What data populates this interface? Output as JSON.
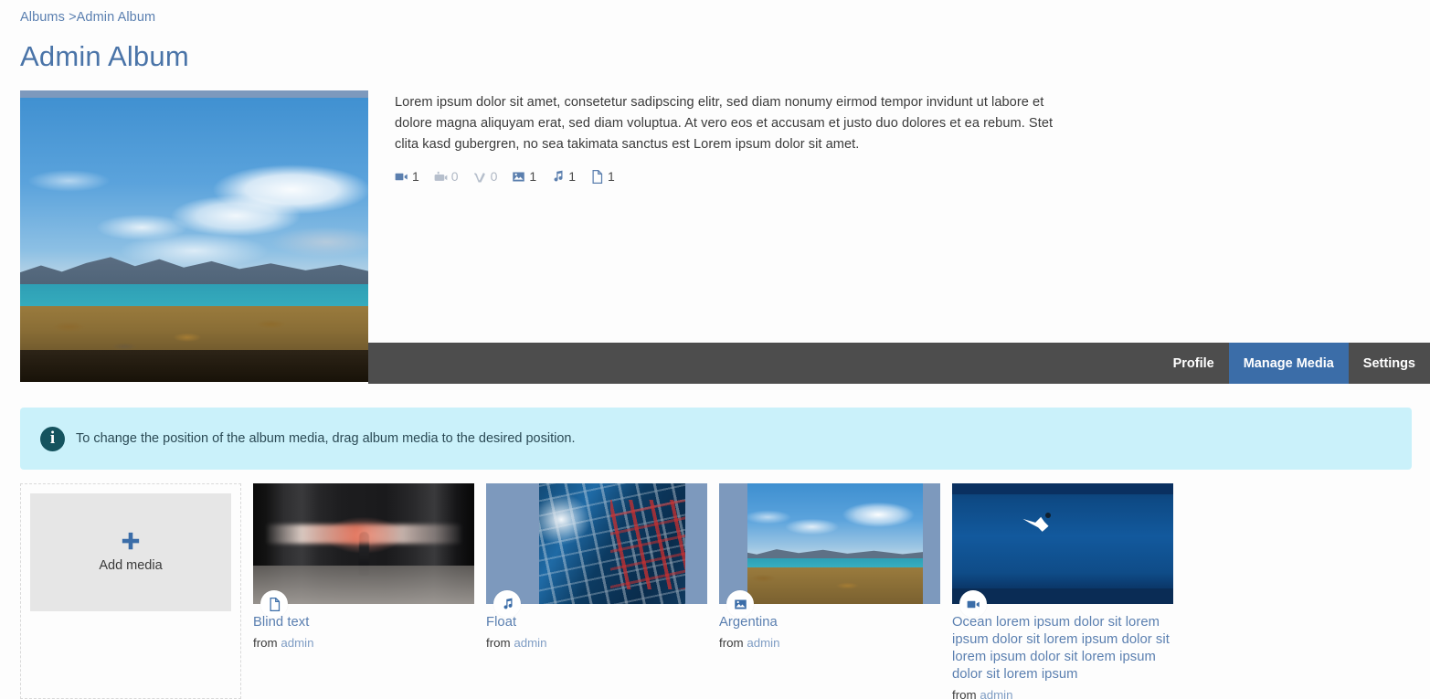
{
  "breadcrumb": {
    "root": "Albums",
    "separator": ">",
    "current": "Admin Album"
  },
  "page_title": "Admin Album",
  "album": {
    "cover_alt": "argentina-landscape-cover",
    "description": "Lorem ipsum dolor sit amet, consetetur sadipscing elitr, sed diam nonumy eirmod tempor invidunt ut labore et dolore magna aliquyam erat, sed diam voluptua. At vero eos et accusam et justo duo dolores et ea rebum. Stet clita kasd gubergren, no sea takimata sanctus est Lorem ipsum dolor sit amet.",
    "counts": [
      {
        "icon": "video-icon",
        "value": "1",
        "muted": false
      },
      {
        "icon": "youtube-icon",
        "value": "0",
        "muted": true
      },
      {
        "icon": "vimeo-icon",
        "value": "0",
        "muted": true
      },
      {
        "icon": "image-icon",
        "value": "1",
        "muted": false
      },
      {
        "icon": "music-icon",
        "value": "1",
        "muted": false
      },
      {
        "icon": "document-icon",
        "value": "1",
        "muted": false
      }
    ]
  },
  "tabs": [
    {
      "label": "Profile",
      "active": false
    },
    {
      "label": "Manage Media",
      "active": true
    },
    {
      "label": "Settings",
      "active": false
    }
  ],
  "info_banner": {
    "icon": "info-icon",
    "glyph": "i",
    "message": "To change the position of the album media, drag album media to the desired position."
  },
  "add_media": {
    "icon": "plus-icon",
    "label": "Add media"
  },
  "media_items": [
    {
      "title": "Blind text",
      "from_label": "from",
      "author": "admin",
      "badge_icon": "document-icon",
      "art": "art-subway"
    },
    {
      "title": "Float",
      "from_label": "from",
      "author": "admin",
      "badge_icon": "music-icon",
      "art": "art-float"
    },
    {
      "title": "Argentina",
      "from_label": "from",
      "author": "admin",
      "badge_icon": "image-icon",
      "art": "art-arg"
    },
    {
      "title": "Ocean lorem ipsum dolor sit lorem ipsum dolor sit lorem ipsum dolor sit lorem ipsum dolor sit lorem ipsum dolor sit lorem ipsum",
      "from_label": "from",
      "author": "admin",
      "badge_icon": "video-icon",
      "art": "art-ocean"
    }
  ],
  "colors": {
    "link": "#5a7fb0",
    "title": "#4a74a8",
    "tab_active_bg": "#3b6da8",
    "tabbar_bg": "#4d4d4d",
    "info_bg": "#caf1fa",
    "info_icon_bg": "#15535e",
    "accent": "#3b6da8",
    "page_bg": "#fdfdfd"
  }
}
